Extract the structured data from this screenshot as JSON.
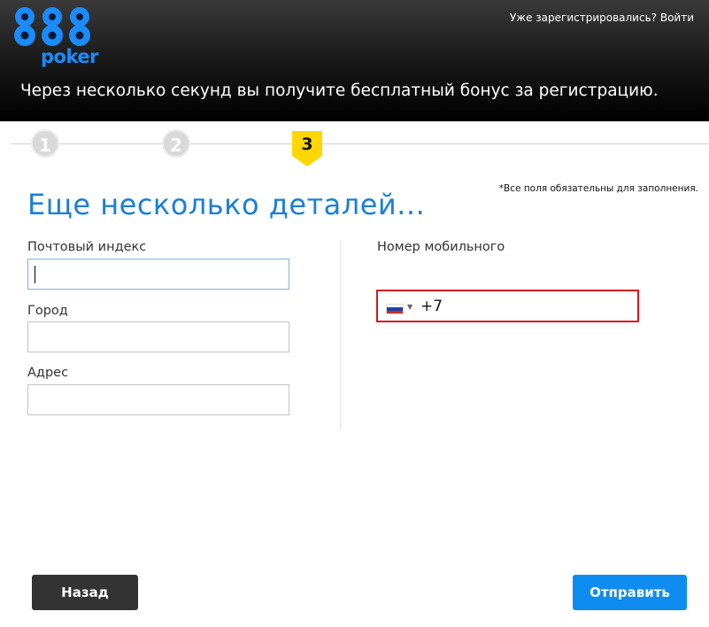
{
  "header": {
    "logo_text": "888",
    "logo_sub": "poker",
    "login_link": "Уже зарегистрировались? Войти",
    "tagline": "Через несколько секунд вы получите бесплатный бонус за регистрацию."
  },
  "steps": {
    "items": [
      "1",
      "2",
      "3"
    ],
    "active": "3"
  },
  "form": {
    "title": "Еще несколько деталей...",
    "required_note": "*Все поля обязательны для заполнения.",
    "postal_code_label": "Почтовый индекс",
    "postal_code_value": "",
    "city_label": "Город",
    "city_value": "",
    "address_label": "Адрес",
    "address_value": "",
    "mobile_label": "Номер мобильного",
    "mobile_country": "Россия",
    "mobile_code": "+7"
  },
  "buttons": {
    "back": "Назад",
    "submit": "Отправить"
  },
  "colors": {
    "accent": "#1a7fd8",
    "submit": "#0f8cf0",
    "back": "#333333",
    "error_border": "#d61a1a",
    "active_step": "#ffd700"
  }
}
